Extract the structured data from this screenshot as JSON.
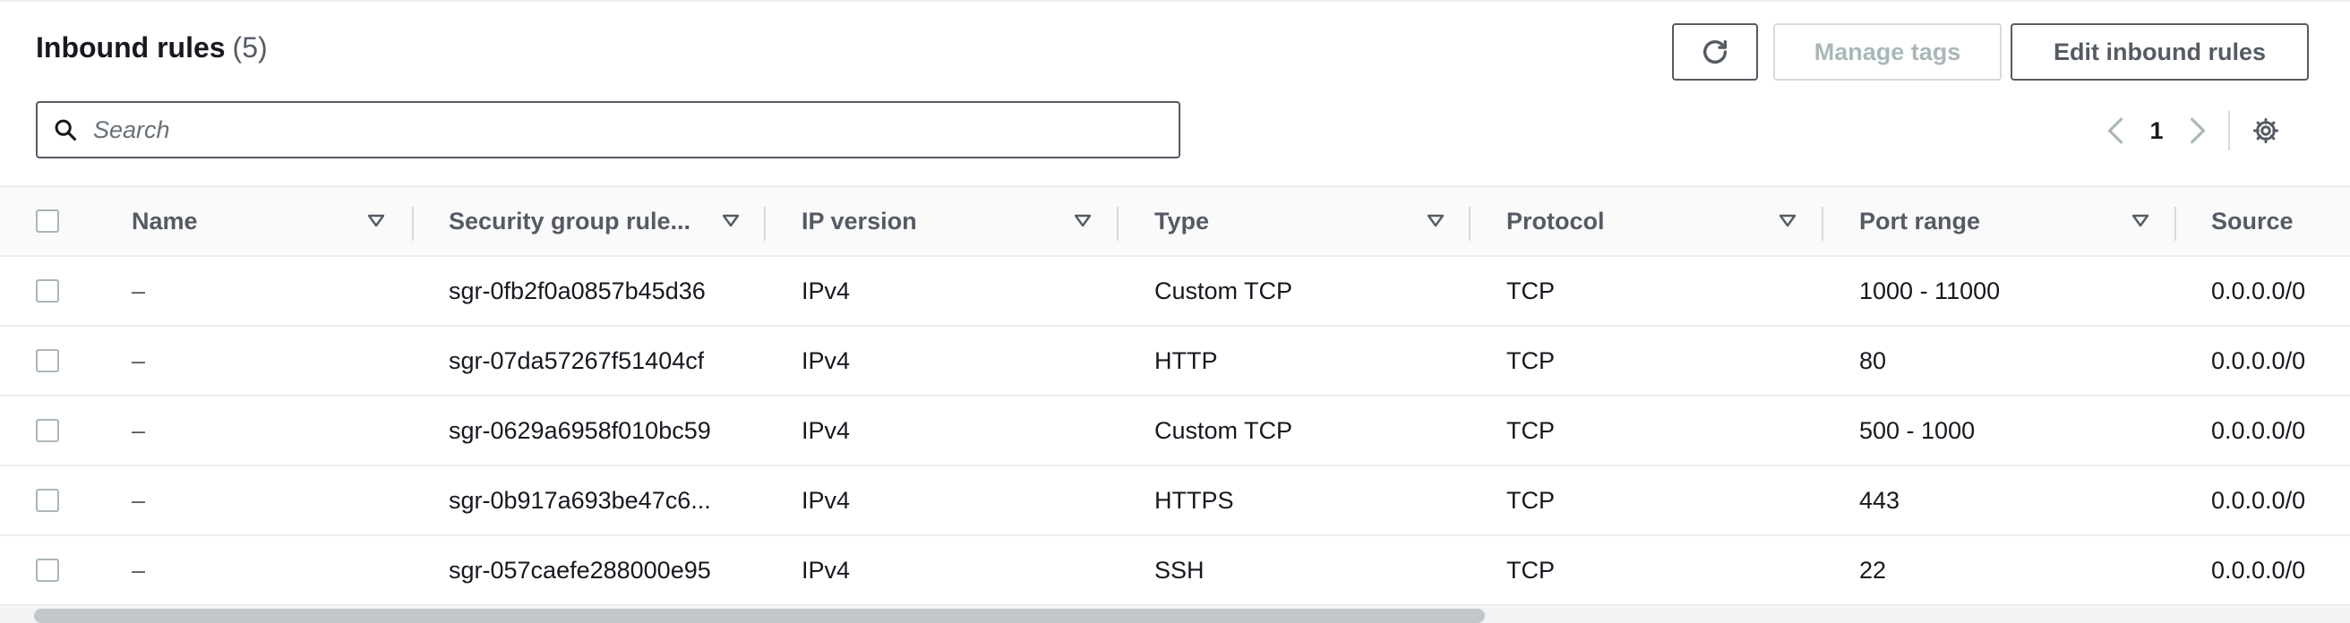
{
  "panel": {
    "title": "Inbound rules",
    "count": "(5)"
  },
  "toolbar": {
    "refresh_icon": "refresh-icon",
    "manage_tags_label": "Manage tags",
    "edit_inbound_rules_label": "Edit inbound rules"
  },
  "search": {
    "placeholder": "Search",
    "value": ""
  },
  "pagination": {
    "current_page": "1"
  },
  "table": {
    "columns": [
      {
        "label": "Name"
      },
      {
        "label": "Security group rule..."
      },
      {
        "label": "IP version"
      },
      {
        "label": "Type"
      },
      {
        "label": "Protocol"
      },
      {
        "label": "Port range"
      },
      {
        "label": "Source"
      }
    ],
    "rows": [
      {
        "name": "–",
        "rule_id": "sgr-0fb2f0a0857b45d36",
        "ip_version": "IPv4",
        "type": "Custom TCP",
        "protocol": "TCP",
        "port_range": "1000 - 11000",
        "source": "0.0.0.0/0"
      },
      {
        "name": "–",
        "rule_id": "sgr-07da57267f51404cf",
        "ip_version": "IPv4",
        "type": "HTTP",
        "protocol": "TCP",
        "port_range": "80",
        "source": "0.0.0.0/0"
      },
      {
        "name": "–",
        "rule_id": "sgr-0629a6958f010bc59",
        "ip_version": "IPv4",
        "type": "Custom TCP",
        "protocol": "TCP",
        "port_range": "500 - 1000",
        "source": "0.0.0.0/0"
      },
      {
        "name": "–",
        "rule_id": "sgr-0b917a693be47c6...",
        "ip_version": "IPv4",
        "type": "HTTPS",
        "protocol": "TCP",
        "port_range": "443",
        "source": "0.0.0.0/0"
      },
      {
        "name": "–",
        "rule_id": "sgr-057caefe288000e95",
        "ip_version": "IPv4",
        "type": "SSH",
        "protocol": "TCP",
        "port_range": "22",
        "source": "0.0.0.0/0"
      }
    ]
  },
  "colors": {
    "text_primary": "#16191f",
    "text_secondary": "#545b64",
    "border": "#eaeded",
    "disabled": "#aab7b8"
  }
}
